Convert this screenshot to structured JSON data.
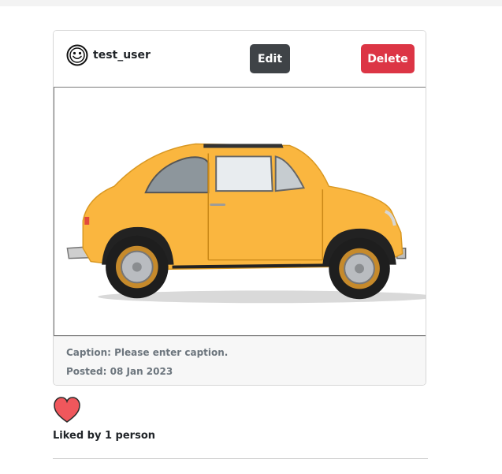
{
  "post": {
    "username": "test_user",
    "edit_label": "Edit",
    "delete_label": "Delete",
    "caption": "Caption: Please enter caption.",
    "posted": "Posted: 08 Jan 2023",
    "liked_by": "Liked by 1 person"
  },
  "icons": {
    "avatar": "smiley-face-icon",
    "like": "heart-icon"
  },
  "colors": {
    "edit_button": "#3f4347",
    "delete_button": "#dc3545",
    "heart": "#f0575c",
    "car_body": "#fab63f"
  }
}
